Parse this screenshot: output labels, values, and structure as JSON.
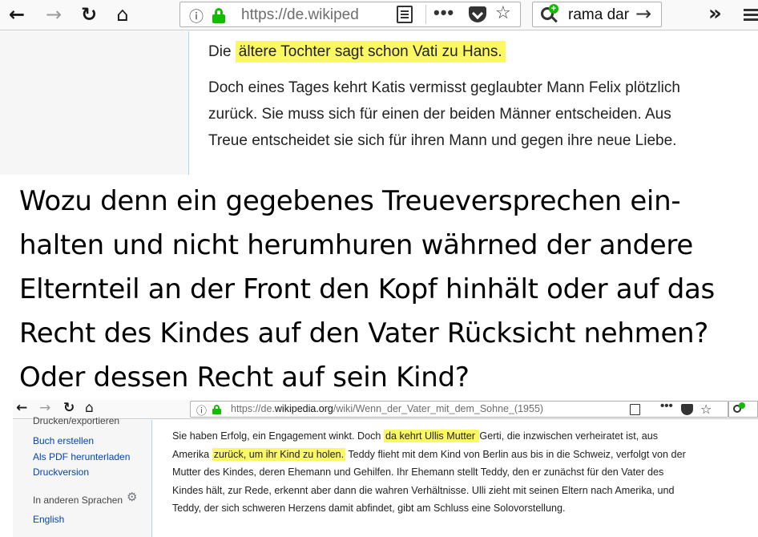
{
  "top_browser": {
    "url": "https://de.wikiped",
    "search_query": "rama dar",
    "overflow": "»",
    "partial_line": "",
    "para1_before": "Die ",
    "para1_highlight": "ältere Tochter sagt schon Vati zu Hans.",
    "para2_lines": [
      "Doch eines Tages kehrt Katis vermisst geglaubter Mann Felix plötzlich",
      "zurück. Sie muss sich für einen der beiden Männer entscheiden. Aus",
      "Treue entscheidet sie sich für ihren Mann und gegen ihre neue Liebe."
    ]
  },
  "comment_lines": [
    "Wozu denn ein gegebenes Treueversprechen ein-",
    "halten und nicht herumhuren währned der andere",
    "Elternteil an der Front den Kopf hinhält oder auf das",
    "Recht des Kindes auf den Vater Rücksicht nehmen?",
    "Oder dessen Recht auf sein Kind?"
  ],
  "bottom_browser": {
    "url_prefix": "https://de.",
    "url_domain": "wikipedia.org",
    "url_path": "/wiki/Wenn_der_Vater_mit_dem_Sohne_(1955)",
    "sidebar": {
      "cut_heading": "Drucken/exportieren",
      "links": [
        "Buch erstellen",
        "Als PDF herunterladen",
        "Druckversion"
      ],
      "languages_heading": "In anderen Sprachen",
      "language_link": "English"
    },
    "article": {
      "l1_before": "Sie haben Erfolg, ein Engagement winkt. Doch ",
      "l1_highlight": "da kehrt Ullis Mutter ",
      "l1_after": "Gerti, die inzwischen verheiratet ist, aus",
      "l2_before": "Amerika ",
      "l2_highlight": "zurück, um ihr Kind zu holen.",
      "l2_after": " Teddy flieht mit dem Kind von Berlin aus bis in die Schweiz, verfolgt von der",
      "l3": "Mutter des Kindes, deren Ehemann und Gehilfen. Ihr Ehemann stellt Teddy, den er zunächst für den Vater des",
      "l4": "Kindes hält, zur Rede, erkennt aber dann die wahren Verhältnisse. Ulli zieht mit seinen Eltern nach Amerika, und",
      "l5": "Teddy, der sich schweren Herzens damit abfindet, gibt am Schluss eine Solovorstellung."
    }
  },
  "colors": {
    "highlight": "#fbf864",
    "link": "#0645ad",
    "secure_lock": "#12bc00"
  }
}
